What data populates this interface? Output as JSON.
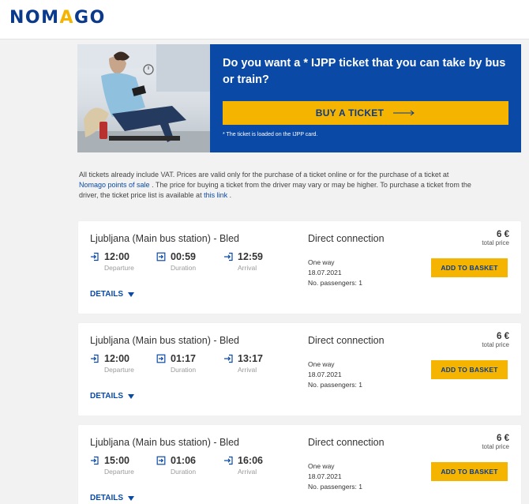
{
  "header": {
    "logo_left": "NOM",
    "logo_accent": "A",
    "logo_right": "GO"
  },
  "promo": {
    "title": "Do you want a * IJPP ticket that you can take by bus or train?",
    "button_label": "BUY A TICKET",
    "note": "* The ticket is loaded on the IJPP card."
  },
  "info": {
    "text_1": "All tickets already include VAT. Prices are valid only for the purchase of a ticket online or for the purchase of a ticket at",
    "link_1": "Nomago points of sale",
    "text_2": ". The price for buying a ticket from the driver may vary or may be higher. To purchase a ticket from the driver, the ticket price list is available at",
    "link_2": "this link",
    "text_3": "."
  },
  "labels": {
    "departure": "Departure",
    "duration": "Duration",
    "arrival": "Arrival",
    "total_price": "total price",
    "add_to_basket": "ADD TO BASKET",
    "details": "DETAILS"
  },
  "trips": [
    {
      "route": "Ljubljana (Main bus station) - Bled",
      "connection": "Direct connection",
      "price": "6 €",
      "departure": "12:00",
      "duration": "00:59",
      "arrival": "12:59",
      "ticket_type": "One way",
      "date": "18.07.2021",
      "passengers": "No. passengers: 1"
    },
    {
      "route": "Ljubljana (Main bus station) - Bled",
      "connection": "Direct connection",
      "price": "6 €",
      "departure": "12:00",
      "duration": "01:17",
      "arrival": "13:17",
      "ticket_type": "One way",
      "date": "18.07.2021",
      "passengers": "No. passengers: 1"
    },
    {
      "route": "Ljubljana (Main bus station) - Bled",
      "connection": "Direct connection",
      "price": "6 €",
      "departure": "15:00",
      "duration": "01:06",
      "arrival": "16:06",
      "ticket_type": "One way",
      "date": "18.07.2021",
      "passengers": "No. passengers: 1"
    }
  ],
  "colors": {
    "brand_blue": "#0a4aa6",
    "accent_yellow": "#f5b400"
  }
}
